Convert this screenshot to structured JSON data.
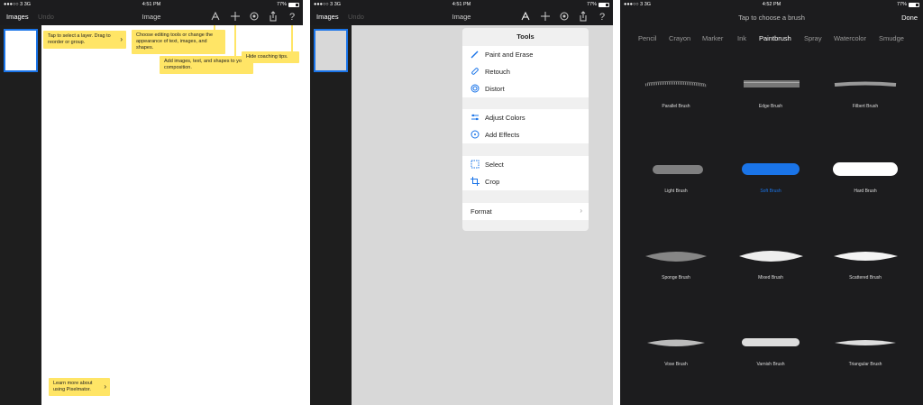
{
  "statusbar": {
    "signal": "●●●○○ 3  3G",
    "battery": "77%",
    "time_left": "4:51 PM",
    "time_mid": "4:51 PM",
    "time_right": "4:52 PM"
  },
  "toolbar": {
    "images_label": "Images",
    "undo_label": "Undo",
    "title": "Image"
  },
  "tips": {
    "layer": "Tap to select a layer. Drag to reorder or group.",
    "editing": "Choose editing tools or change the appearance of text, images, and shapes.",
    "add": "Add images, text, and shapes to your composition.",
    "hide": "Hide coaching tips.",
    "learn": "Learn more about using Pixelmator."
  },
  "tools_popover": {
    "title": "Tools",
    "groups": [
      [
        {
          "label": "Paint and Erase",
          "icon": "brush-icon"
        },
        {
          "label": "Retouch",
          "icon": "bandage-icon"
        },
        {
          "label": "Distort",
          "icon": "spiral-icon"
        }
      ],
      [
        {
          "label": "Adjust Colors",
          "icon": "sliders-icon"
        },
        {
          "label": "Add Effects",
          "icon": "effects-icon"
        }
      ],
      [
        {
          "label": "Select",
          "icon": "marquee-icon"
        },
        {
          "label": "Crop",
          "icon": "crop-icon"
        }
      ],
      [
        {
          "label": "Format",
          "icon": "chevron-right-icon"
        }
      ]
    ]
  },
  "brush_picker": {
    "hint": "Tap to choose a brush",
    "done_label": "Done",
    "categories": [
      "Pencil",
      "Crayon",
      "Marker",
      "Ink",
      "Paintbrush",
      "Spray",
      "Watercolor",
      "Smudge"
    ],
    "active_category": "Paintbrush",
    "brushes": [
      "Parallel Brush",
      "Edge Brush",
      "Filbert Brush",
      "Light Brush",
      "Soft Brush",
      "Hard Brush",
      "Sponge Brush",
      "Mixed Brush",
      "Scattered Brush",
      "Vose Brush",
      "Varnish Brush",
      "Triangular Brush"
    ],
    "selected_brush": "Soft Brush"
  },
  "colors": {
    "accent": "#1a74e8",
    "tip_yellow": "#ffe566",
    "dark_bg": "#1c1c1e"
  }
}
